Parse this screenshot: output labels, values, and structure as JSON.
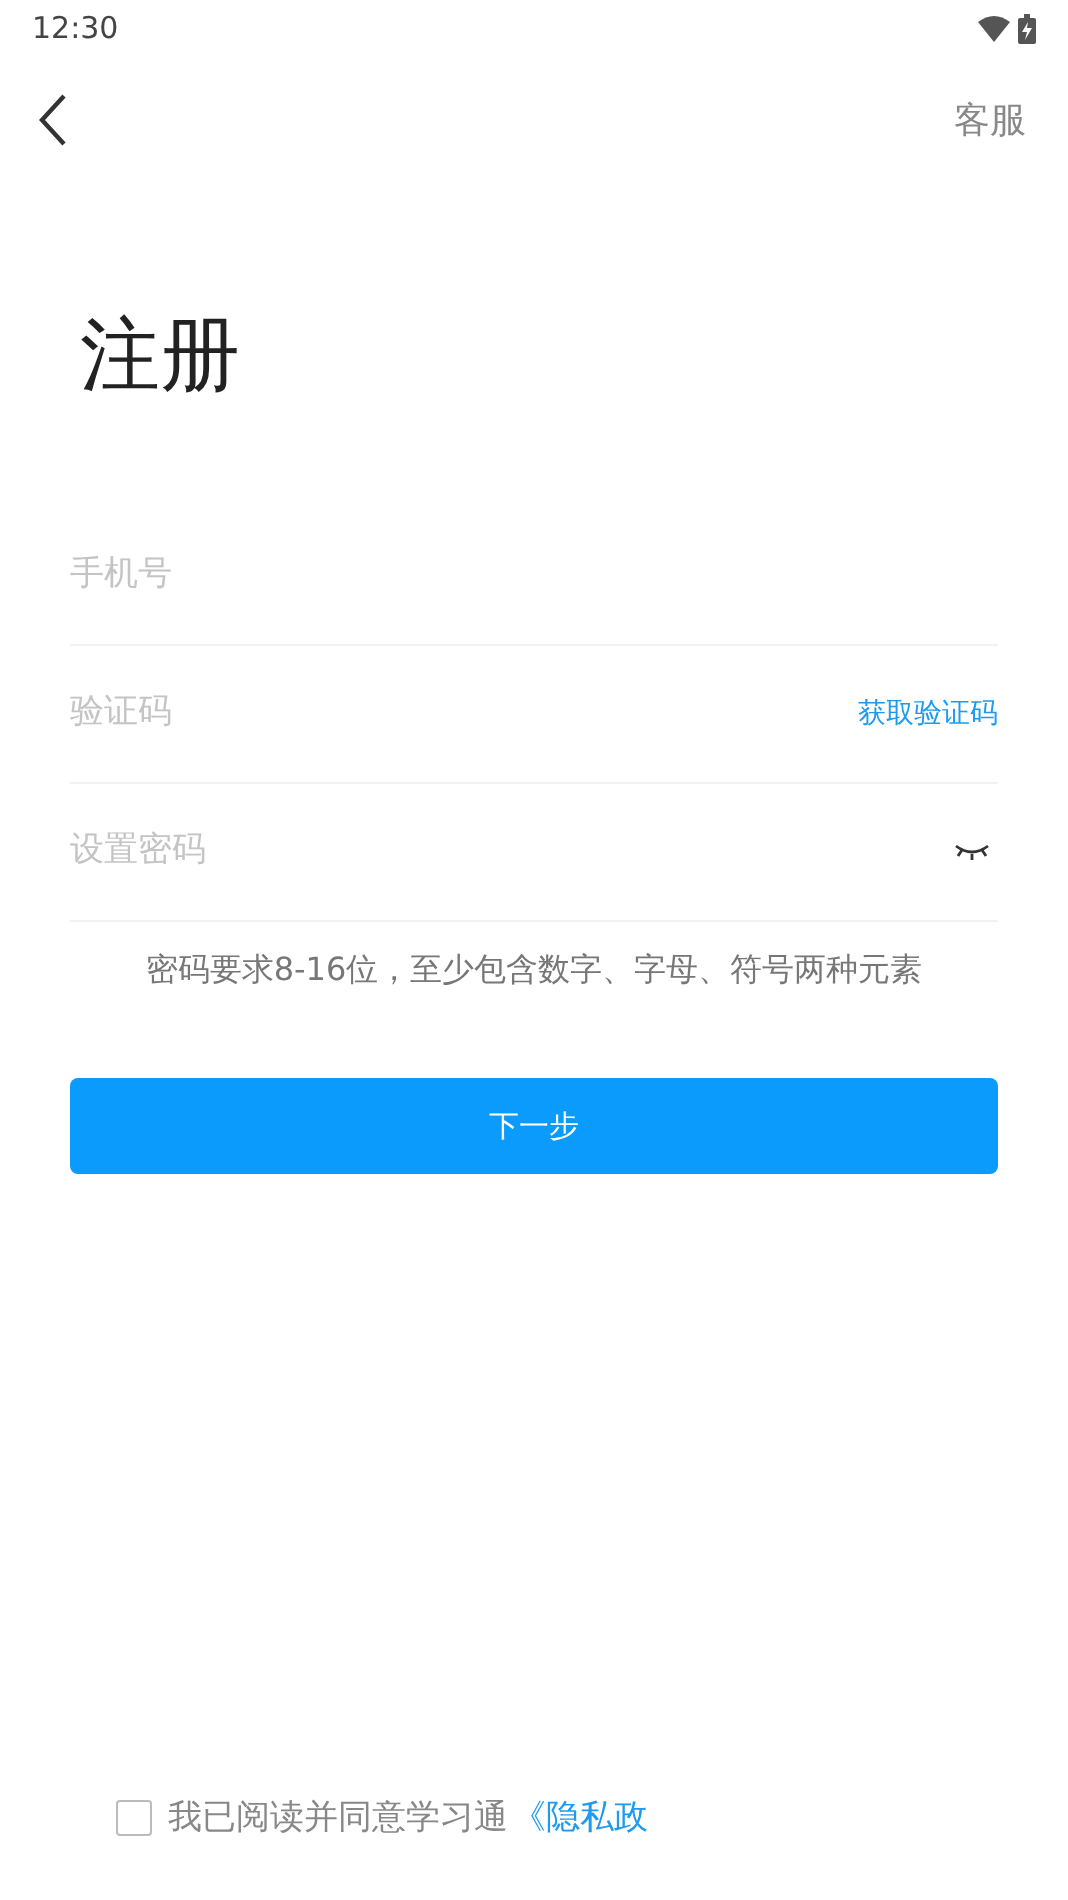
{
  "status_bar": {
    "time": "12:30"
  },
  "header": {
    "action": "客服"
  },
  "title": "注册",
  "fields": [
    {
      "kind": "phone",
      "placeholder": "手机号"
    },
    {
      "kind": "code",
      "placeholder": "验证码",
      "action": "获取验证码"
    },
    {
      "kind": "password",
      "placeholder": "设置密码"
    }
  ],
  "hint": "密码要求8-16位，至少包含数字、字母、符号两种元素",
  "next_button": "下一步",
  "agreement": {
    "checked": false,
    "text": "我已阅读并同意学习通",
    "link": "《隐私政"
  }
}
